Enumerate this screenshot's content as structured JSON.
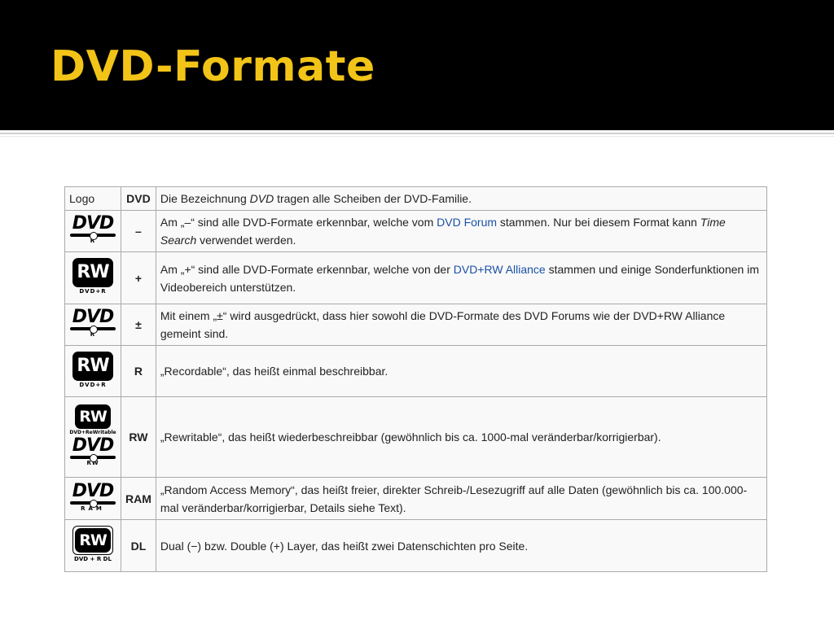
{
  "slide": {
    "title": "DVD-Formate"
  },
  "table": {
    "header": {
      "logo": "Logo",
      "code": "DVD",
      "text_pre": "Die Bezeichnung ",
      "text_em": "DVD",
      "text_post": " tragen alle Scheiben der DVD-Familie."
    },
    "rows": [
      {
        "code": "–",
        "logo": {
          "kind": "dvd",
          "word": "DVD",
          "sub": "R"
        },
        "t1": "Am „–“ sind alle DVD-Formate erkennbar, welche vom ",
        "link": "DVD Forum",
        "t2": " stammen. Nur bei diesem Format kann ",
        "em": "Time Search",
        "t3": " verwendet werden."
      },
      {
        "code": "+",
        "logo": {
          "kind": "rw",
          "word": "RW",
          "sub": "DVD+R"
        },
        "t1": "Am „+“ sind alle DVD-Formate erkennbar, welche von der ",
        "link": "DVD+RW Alliance",
        "t2": " stammen und einige Sonderfunktionen im Videobereich unterstützen."
      },
      {
        "code": "±",
        "logo": {
          "kind": "dvd",
          "word": "DVD",
          "sub": "R"
        },
        "t1": "Mit einem „±“ wird ausgedrückt, dass hier sowohl die DVD-Formate des DVD Forums wie der DVD+RW Alliance gemeint sind."
      },
      {
        "code": "R",
        "logo": {
          "kind": "rw",
          "word": "RW",
          "sub": "DVD+R"
        },
        "t1": "„Recordable“, das heißt einmal beschreibbar."
      },
      {
        "code": "RW",
        "logo": {
          "kind": "combo",
          "word": "RW",
          "sub": "DVD+ReWritable",
          "word2": "DVD",
          "sub2": "RW"
        },
        "t1": "„Rewritable“, das heißt wiederbeschreibbar (gewöhnlich bis ca. 1000-mal veränderbar/korrigierbar)."
      },
      {
        "code": "RAM",
        "logo": {
          "kind": "dvd",
          "word": "DVD",
          "sub": "RAM"
        },
        "t1": "„Random Access Memory“, das heißt freier, direkter Schreib-/Lesezugriff auf alle Daten (gewöhnlich bis ca. 100.000-mal veränderbar/korrigierbar, Details siehe Text)."
      },
      {
        "code": "DL",
        "logo": {
          "kind": "rwdl",
          "word": "RW",
          "sub": "DVD + R DL"
        },
        "t1": "Dual (−) bzw. Double (+) Layer, das heißt zwei Datenschichten pro Seite."
      }
    ]
  },
  "colors": {
    "title": "#f2c418",
    "header_bg": "#000000",
    "link": "#1a50a6",
    "cell_bg": "#f9f9f9",
    "border": "#aaaaaa"
  }
}
